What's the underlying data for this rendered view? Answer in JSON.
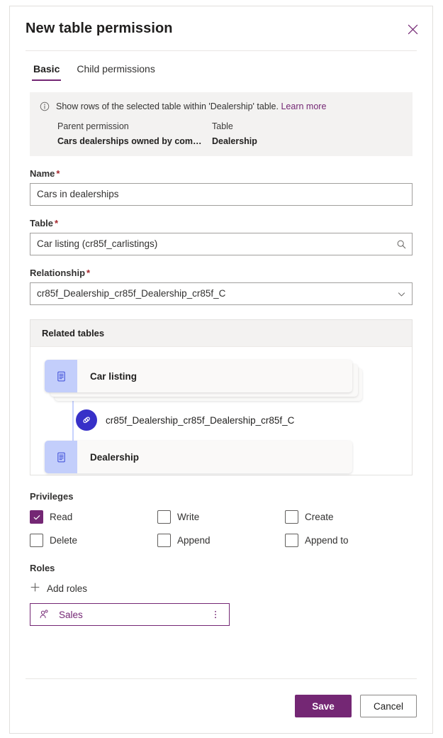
{
  "dialog": {
    "title": "New table permission",
    "close_icon": "close-icon"
  },
  "tabs": [
    {
      "label": "Basic",
      "active": true
    },
    {
      "label": "Child permissions",
      "active": false
    }
  ],
  "banner": {
    "icon": "info-icon",
    "message": "Show rows of the selected table within 'Dealership' table.",
    "link_label": "Learn more",
    "columns": [
      "Parent permission",
      "Table"
    ],
    "values": [
      "Cars dealerships owned by compa...",
      "Dealership"
    ]
  },
  "fields": {
    "name": {
      "label": "Name",
      "required_marker": "*",
      "value": "Cars in dealerships",
      "placeholder": "Name"
    },
    "table": {
      "label": "Table",
      "required_marker": "*",
      "value": "Car listing (cr85f_carlistings)",
      "placeholder": "Table",
      "icon": "search-icon"
    },
    "relationship": {
      "label": "Relationship",
      "required_marker": "*",
      "value": "cr85f_Dealership_cr85f_Dealership_cr85f_C",
      "icon": "chevron-down-icon"
    }
  },
  "related_tables": {
    "header": "Related tables",
    "source_node": {
      "label": "Car listing",
      "icon": "table-icon",
      "stacked": true
    },
    "relationship_node": {
      "label": "cr85f_Dealership_cr85f_Dealership_cr85f_C",
      "icon": "link-icon"
    },
    "target_node": {
      "label": "Dealership",
      "icon": "table-icon",
      "stacked": false
    }
  },
  "privileges": {
    "label": "Privileges",
    "items": [
      {
        "label": "Read",
        "checked": true
      },
      {
        "label": "Write",
        "checked": false
      },
      {
        "label": "Create",
        "checked": false
      },
      {
        "label": "Delete",
        "checked": false
      },
      {
        "label": "Append",
        "checked": false
      },
      {
        "label": "Append to",
        "checked": false
      }
    ]
  },
  "roles": {
    "label": "Roles",
    "add_label": "Add roles",
    "add_icon": "plus-icon",
    "chips": [
      {
        "name": "Sales",
        "icon": "person-icon",
        "more_icon": "more-vertical-icon"
      }
    ]
  },
  "footer": {
    "save_label": "Save",
    "cancel_label": "Cancel"
  },
  "colors": {
    "accent": "#742774",
    "required": "#a4262c",
    "banner_bg": "#f3f2f1",
    "node_icon_bg": "#c3cefb",
    "link_badge_bg": "#3730c8"
  }
}
